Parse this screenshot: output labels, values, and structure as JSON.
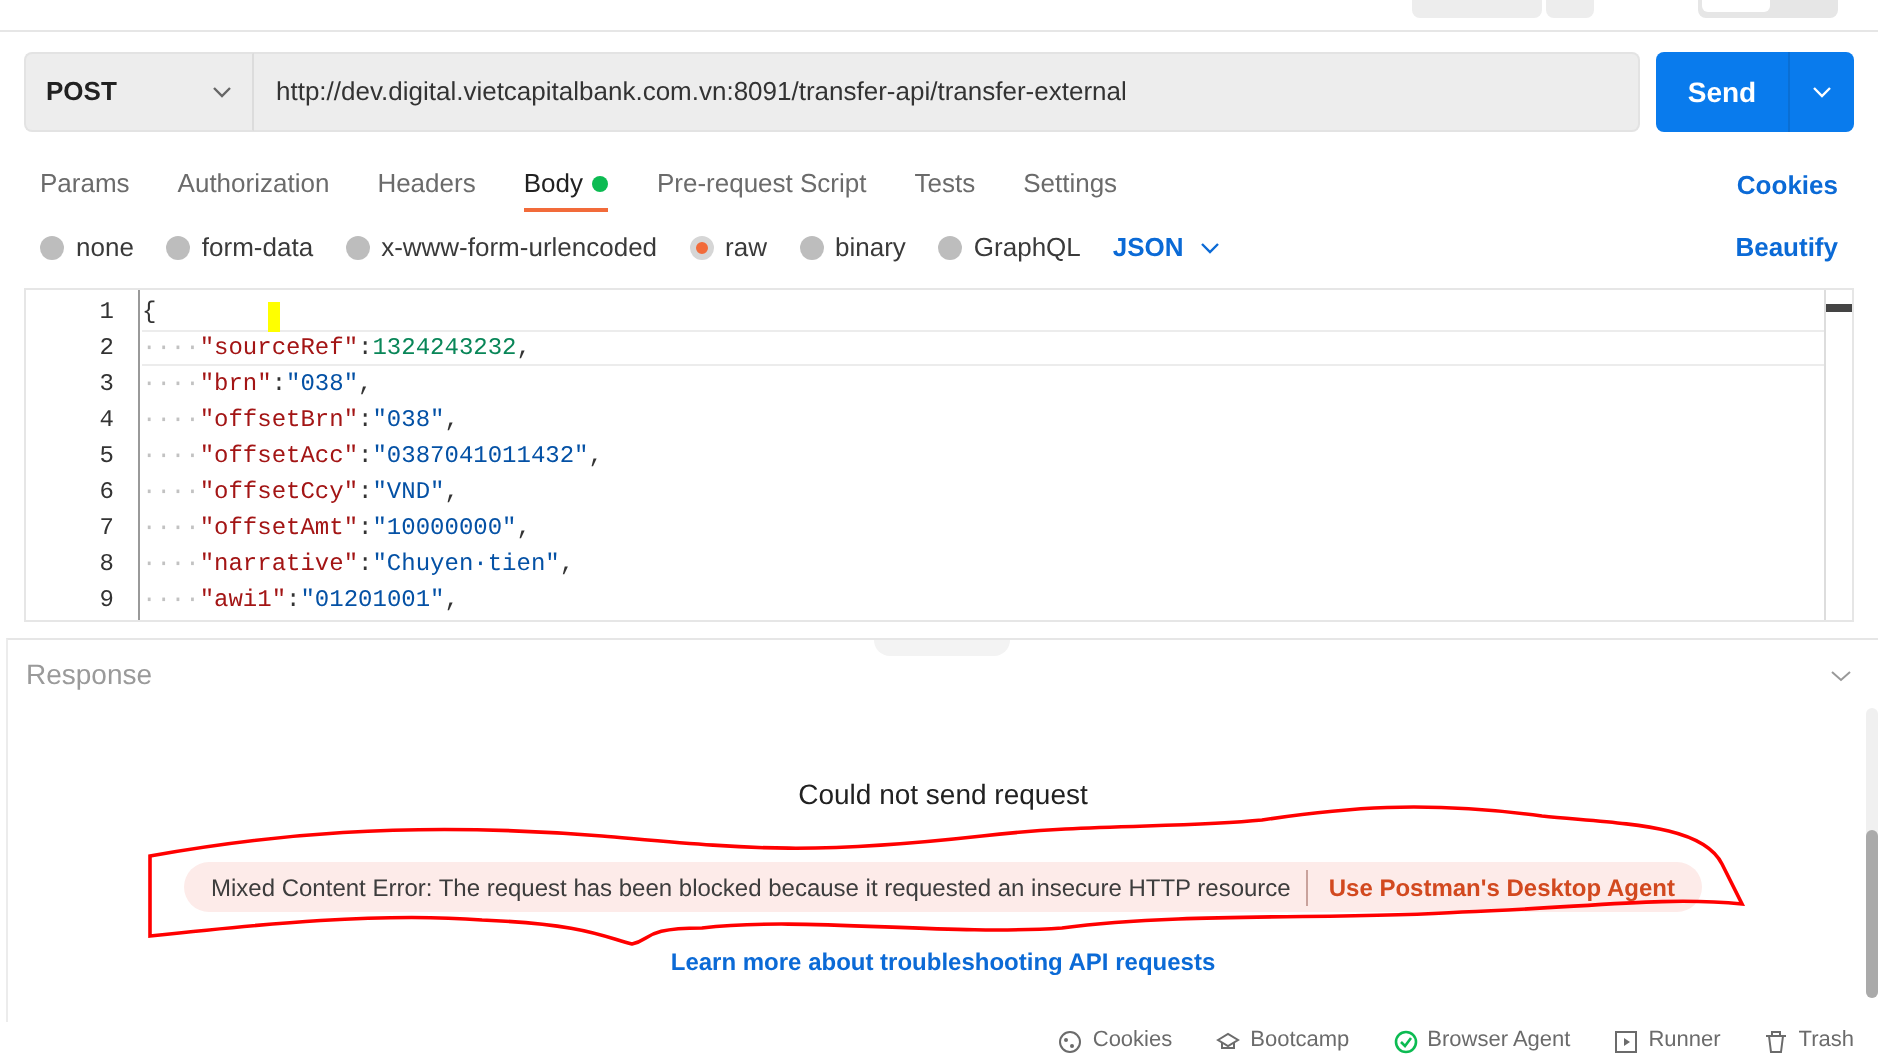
{
  "top_toggle": {
    "on": false
  },
  "request": {
    "method": "POST",
    "url": "http://dev.digital.vietcapitalbank.com.vn:8091/transfer-api/transfer-external",
    "send_label": "Send"
  },
  "tabs": [
    {
      "label": "Params",
      "selected": false,
      "dot": false
    },
    {
      "label": "Authorization",
      "selected": false,
      "dot": false
    },
    {
      "label": "Headers",
      "selected": false,
      "dot": false
    },
    {
      "label": "Body",
      "selected": true,
      "dot": true
    },
    {
      "label": "Pre-request Script",
      "selected": false,
      "dot": false
    },
    {
      "label": "Tests",
      "selected": false,
      "dot": false
    },
    {
      "label": "Settings",
      "selected": false,
      "dot": false
    }
  ],
  "cookies_link": "Cookies",
  "body_types": [
    {
      "label": "none",
      "selected": false
    },
    {
      "label": "form-data",
      "selected": false
    },
    {
      "label": "x-www-form-urlencoded",
      "selected": false
    },
    {
      "label": "raw",
      "selected": true
    },
    {
      "label": "binary",
      "selected": false
    },
    {
      "label": "GraphQL",
      "selected": false
    }
  ],
  "format": "JSON",
  "beautify_link": "Beautify",
  "editor": {
    "lines": [
      {
        "number": "1",
        "tokens": [
          {
            "kind": "punct",
            "text": "{"
          }
        ]
      },
      {
        "number": "2",
        "tokens": [
          {
            "kind": "indent",
            "text": "····"
          },
          {
            "kind": "key",
            "text": "\"sourceRef\""
          },
          {
            "kind": "punct",
            "text": ":"
          },
          {
            "kind": "number",
            "text": "1324243232"
          },
          {
            "kind": "punct",
            "text": ","
          }
        ]
      },
      {
        "number": "3",
        "tokens": [
          {
            "kind": "indent",
            "text": "····"
          },
          {
            "kind": "key",
            "text": "\"brn\""
          },
          {
            "kind": "punct",
            "text": ":"
          },
          {
            "kind": "string",
            "text": "\"038\""
          },
          {
            "kind": "punct",
            "text": ","
          }
        ]
      },
      {
        "number": "4",
        "tokens": [
          {
            "kind": "indent",
            "text": "····"
          },
          {
            "kind": "key",
            "text": "\"offsetBrn\""
          },
          {
            "kind": "punct",
            "text": ":"
          },
          {
            "kind": "string",
            "text": "\"038\""
          },
          {
            "kind": "punct",
            "text": ","
          }
        ]
      },
      {
        "number": "5",
        "tokens": [
          {
            "kind": "indent",
            "text": "····"
          },
          {
            "kind": "key",
            "text": "\"offsetAcc\""
          },
          {
            "kind": "punct",
            "text": ":"
          },
          {
            "kind": "string",
            "text": "\"0387041011432\""
          },
          {
            "kind": "punct",
            "text": ","
          }
        ]
      },
      {
        "number": "6",
        "tokens": [
          {
            "kind": "indent",
            "text": "····"
          },
          {
            "kind": "key",
            "text": "\"offsetCcy\""
          },
          {
            "kind": "punct",
            "text": ":"
          },
          {
            "kind": "string",
            "text": "\"VND\""
          },
          {
            "kind": "punct",
            "text": ","
          }
        ]
      },
      {
        "number": "7",
        "tokens": [
          {
            "kind": "indent",
            "text": "····"
          },
          {
            "kind": "key",
            "text": "\"offsetAmt\""
          },
          {
            "kind": "punct",
            "text": ":"
          },
          {
            "kind": "string",
            "text": "\"10000000\""
          },
          {
            "kind": "punct",
            "text": ","
          }
        ]
      },
      {
        "number": "8",
        "tokens": [
          {
            "kind": "indent",
            "text": "····"
          },
          {
            "kind": "key",
            "text": "\"narrative\""
          },
          {
            "kind": "punct",
            "text": ":"
          },
          {
            "kind": "string",
            "text": "\"Chuyen·tien\""
          },
          {
            "kind": "punct",
            "text": ","
          }
        ]
      },
      {
        "number": "9",
        "tokens": [
          {
            "kind": "indent",
            "text": "····"
          },
          {
            "kind": "key",
            "text": "\"awi1\""
          },
          {
            "kind": "punct",
            "text": ":"
          },
          {
            "kind": "string",
            "text": "\"01201001\""
          },
          {
            "kind": "punct",
            "text": ","
          }
        ]
      }
    ]
  },
  "response": {
    "title": "Response",
    "heading": "Could not send request",
    "error": "Mixed Content Error: The request has been blocked because it requested an insecure HTTP resource",
    "error_action": "Use Postman's Desktop Agent",
    "help_link": "Learn more about troubleshooting API requests"
  },
  "status_bar": [
    {
      "label": "Cookies",
      "kind": "cookie"
    },
    {
      "label": "Bootcamp",
      "kind": "bootcamp"
    },
    {
      "label": "Browser Agent",
      "kind": "agent"
    },
    {
      "label": "Runner",
      "kind": "runner"
    },
    {
      "label": "Trash",
      "kind": "trash"
    }
  ]
}
